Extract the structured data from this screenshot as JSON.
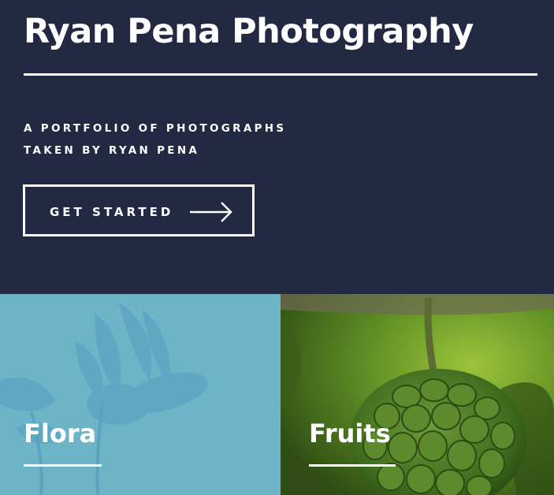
{
  "header": {
    "title": "Ryan Pena Photography",
    "subtitle_line1": "A portfolio of photographs",
    "subtitle_line2": "taken by Ryan Pena",
    "cta_label": "GET STARTED",
    "cta_icon": "arrow-right-icon"
  },
  "tiles": [
    {
      "title": "Flora"
    },
    {
      "title": "Fruits"
    }
  ],
  "colors": {
    "background": "#242943",
    "text": "#ffffff",
    "flora_overlay": "#6bb5c6",
    "fruits_green": "#4a7a20"
  }
}
